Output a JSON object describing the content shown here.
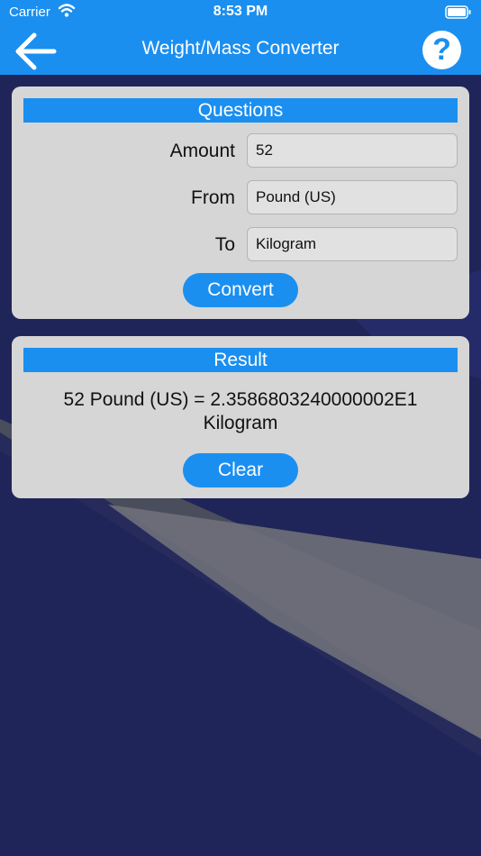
{
  "status_bar": {
    "carrier": "Carrier",
    "time": "8:53 PM",
    "wifi_icon": "wifi-icon",
    "battery_icon": "battery-icon"
  },
  "nav": {
    "title": "Weight/Mass Converter",
    "back_icon": "arrow-left-icon",
    "help_label": "?"
  },
  "questions": {
    "header": "Questions",
    "amount_label": "Amount",
    "amount_value": "52",
    "from_label": "From",
    "from_value": "Pound (US)",
    "to_label": "To",
    "to_value": "Kilogram",
    "convert_label": "Convert"
  },
  "result": {
    "header": "Result",
    "text_line1": "52 Pound (US) = 2.3586803240000002E1",
    "text_line2": "Kilogram",
    "clear_label": "Clear"
  },
  "colors": {
    "accent": "#1a8ff0",
    "card": "#d6d6d6",
    "background": "#1e2457"
  }
}
